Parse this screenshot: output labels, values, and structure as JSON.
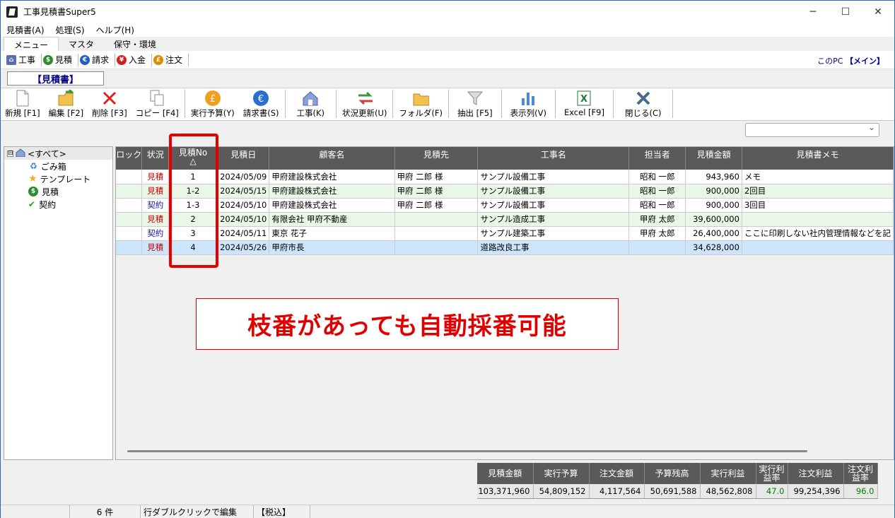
{
  "window": {
    "title": "工事見積書Super5",
    "btn_min": "─",
    "btn_max": "☐",
    "btn_close": "✕"
  },
  "menu": [
    "見積書(A)",
    "処理(S)",
    "ヘルプ(H)"
  ],
  "tabs": [
    "メニュー",
    "マスタ",
    "保守・環境"
  ],
  "quickbar": {
    "items": [
      {
        "label": "工事",
        "icon": "house-icon",
        "color": "#5a6fb0"
      },
      {
        "label": "見積",
        "icon": "dollar-icon",
        "color": "#2e8b2e"
      },
      {
        "label": "請求",
        "icon": "euro-icon",
        "color": "#1f5fbf"
      },
      {
        "label": "入金",
        "icon": "yen-icon",
        "color": "#d02020"
      },
      {
        "label": "注文",
        "icon": "pound-icon",
        "color": "#e08a00"
      }
    ],
    "pc_label": "このPC",
    "pc_name": "【メイン】"
  },
  "section_label": "【見積書】",
  "toolbar": [
    {
      "label": "新規 [F1]",
      "icon": "new-document-icon"
    },
    {
      "label": "編集 [F2]",
      "icon": "edit-folder-icon"
    },
    {
      "label": "削除 [F3]",
      "icon": "delete-x-icon"
    },
    {
      "label": "コピー [F4]",
      "icon": "copy-icon"
    },
    {
      "label": "実行予算(Y)",
      "icon": "pound-coin-icon"
    },
    {
      "label": "請求書(S)",
      "icon": "euro-coin-icon"
    },
    {
      "label": "工事(K)",
      "icon": "house-icon"
    },
    {
      "label": "状況更新(U)",
      "icon": "refresh-icon"
    },
    {
      "label": "フォルダ(F)",
      "icon": "folder-icon"
    },
    {
      "label": "抽出 [F5]",
      "icon": "filter-funnel-icon"
    },
    {
      "label": "表示列(V)",
      "icon": "columns-chart-icon"
    },
    {
      "label": "Excel [F9]",
      "icon": "excel-icon"
    },
    {
      "label": "閉じる(C)",
      "icon": "close-x-icon"
    }
  ],
  "tree": [
    {
      "label": "<すべて>",
      "icon": "house-icon",
      "expander": "⊟"
    },
    {
      "label": "ごみ箱",
      "icon": "recycle-bin-icon"
    },
    {
      "label": "テンプレート",
      "icon": "star-icon"
    },
    {
      "label": "見積",
      "icon": "dollar-icon"
    },
    {
      "label": "契約",
      "icon": "checkmark-icon"
    }
  ],
  "grid": {
    "columns": [
      "ロック",
      "状況",
      "見積No",
      "見積日",
      "顧客名",
      "見積先",
      "工事名",
      "担当者",
      "見積金額",
      "見積書メモ"
    ],
    "sort_indicator": "△",
    "rows": [
      {
        "lock": "",
        "status": "見積",
        "no": "1",
        "date": "2024/05/09",
        "customer": "甲府建設株式会社",
        "dest": "甲府 二郎 様",
        "project": "サンプル設備工事",
        "staff": "昭和 一郎",
        "amount": "943,960",
        "memo": "メモ"
      },
      {
        "lock": "",
        "status": "見積",
        "no": "1-2",
        "date": "2024/05/15",
        "customer": "甲府建設株式会社",
        "dest": "甲府 二郎 様",
        "project": "サンプル設備工事",
        "staff": "昭和 一郎",
        "amount": "900,000",
        "memo": "2回目"
      },
      {
        "lock": "",
        "status": "契約",
        "no": "1-3",
        "date": "2024/05/10",
        "customer": "甲府建設株式会社",
        "dest": "甲府 二郎 様",
        "project": "サンプル設備工事",
        "staff": "昭和 一郎",
        "amount": "900,000",
        "memo": "3回目"
      },
      {
        "lock": "",
        "status": "見積",
        "no": "2",
        "date": "2024/05/10",
        "customer": "有限会社 甲府不動産",
        "dest": "",
        "project": "サンプル造成工事",
        "staff": "甲府 太郎",
        "amount": "39,600,000",
        "memo": ""
      },
      {
        "lock": "",
        "status": "契約",
        "no": "3",
        "date": "2024/05/11",
        "customer": "東京 花子",
        "dest": "",
        "project": "サンプル建築工事",
        "staff": "甲府 太郎",
        "amount": "26,400,000",
        "memo": "ここに印刷しない社内管理情報などを記"
      },
      {
        "lock": "",
        "status": "見積",
        "no": "4",
        "date": "2024/05/26",
        "customer": "甲府市長",
        "dest": "",
        "project": "道路改良工事",
        "staff": "",
        "amount": "34,628,000",
        "memo": ""
      }
    ]
  },
  "callout": "枝番があっても自動採番可能",
  "summary": {
    "headers": [
      "見積金額",
      "実行予算",
      "注文金額",
      "予算残高",
      "実行利益",
      "実行利\n益率",
      "注文利益",
      "注文利\n益率"
    ],
    "values": [
      "103,371,960",
      "54,809,152",
      "4,117,564",
      "50,691,588",
      "48,562,808",
      "47.0",
      "99,254,396",
      "96.0"
    ]
  },
  "status": {
    "count": "6 件",
    "hint": "行ダブルクリックで編集",
    "tax": "【税込】"
  }
}
